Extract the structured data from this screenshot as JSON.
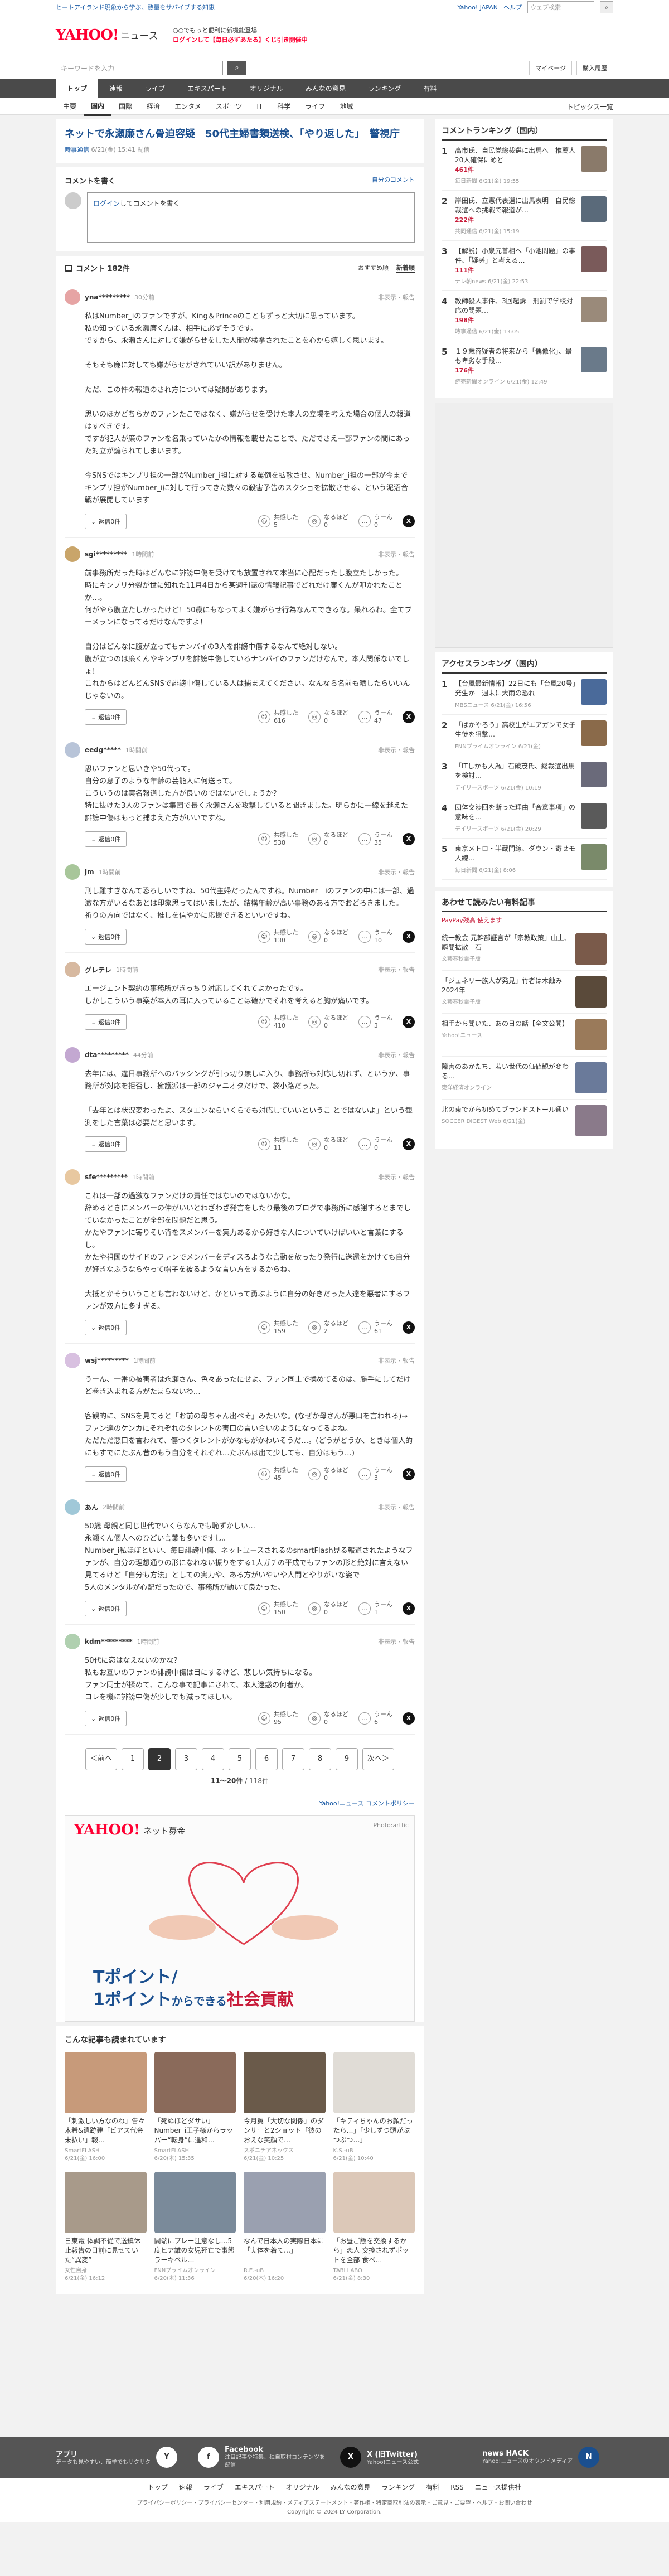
{
  "top_ad": {
    "text": "ヒートアイランド現象から学ぶ、熱量をサバイブする知恵",
    "links": [
      "Yahoo! JAPAN",
      "ヘルプ"
    ],
    "search_placeholder": "ウェブ検索"
  },
  "header": {
    "logo_brand": "YAHOO!",
    "logo_service": "ニュース",
    "promo_line1": "○○でもっと便利に新機能登場",
    "promo_line2": "ログインして【毎日必ずあたる】くじ引き開催中"
  },
  "subbar": {
    "search_placeholder": "キーワードを入力",
    "search_button": "検索",
    "mypage": "マイページ",
    "subscribe": "購入履歴"
  },
  "global_nav": [
    "トップ",
    "速報",
    "ライブ",
    "エキスパート",
    "オリジナル",
    "みんなの意見",
    "ランキング",
    "有料"
  ],
  "category_nav": [
    "主要",
    "国内",
    "国際",
    "経済",
    "エンタメ",
    "スポーツ",
    "IT",
    "科学",
    "ライフ",
    "地域"
  ],
  "category_nav_topics": "トピックス一覧",
  "article": {
    "title": "ネットで永瀬廉さん骨迫容疑　50代主婦書類送検、「やり返した」　警視庁",
    "source": "時事通信",
    "date": "6/21(金) 15:41 配信"
  },
  "comment_form": {
    "title": "コメントを書く",
    "mine": "自分のコメント",
    "placeholder_link": "ログイン",
    "placeholder_rest": "してコメントを書く"
  },
  "comments_section": {
    "title": "コメント 182件",
    "sort_recommended": "おすすめ順",
    "sort_new": "新着順"
  },
  "labels": {
    "reply": "返信0件",
    "report": "非表示・報告",
    "empathy": "共感した",
    "insight": "なるほど",
    "hmm": "うーん"
  },
  "comments": [
    {
      "name": "yna*********",
      "time": "30分前",
      "body": "私はNumber_iのファンですが、King＆Princeのこともずっと大切に思っています。\n私の知っている永瀬廉くんは、相手に必ずそうです。\nですから、永瀬さんに対して嫌がらせをした人間が検挙されたことを心から嬉しく思います。\n\nそもそも廉に対しても嫌がらせがされていい訳がありません。\n\nただ、この件の報道のされ方については疑問があります。\n\n思いのほかどちらかのファンたこではなく、嫌がらせを受けた本人の立場を考えた場合の個人の報道はすべきです。\nですが犯人が廉のファンを名乗っていたかの情報を載せたことで、ただでさえ一部ファンの間にあった対立が煽られてしまいます。\n\n今SNSではキンプリ担の一部がNumber_i担に対する罵倒を拡散させ、Number_i担の一部が今までキンプリ担がNumber_iに対して行ってきた数々の殺害予告のスクショを拡散させる、という泥沼合戦が展開しています",
      "empathy": "5",
      "insight": "0",
      "hmm": "0",
      "color": "#e6a4a4"
    },
    {
      "name": "sgi*********",
      "time": "1時間前",
      "body": "前事務所だった時はどんなに誹謗中傷を受けても放置されて本当に心配だったし腹立たしかった。\n時にキンプリ分裂が世に知れた11月4日から某週刊誌の情報記事でどれだけ廉くんが叩かれたことか…。\n何がやら腹立たしかったけど！50歳にもなってよく嫌がらせ行為なんてできるな。呆れるわ。全てブーメランになってるだけなんですよ！\n\n自分はどんなに腹が立ってもナンバイの3人を誹謗中傷するなんて絶対しない。\n腹が立つのは廉くんやキンプリを誹謗中傷しているナンバイのファンだけなんで。本人関係ないでしょ！\nこれからはどんどんSNSで誹謗中傷している人は捕まえてください。なんなら名前も晒したらいいんじゃないの。",
      "empathy": "616",
      "insight": "0",
      "hmm": "47",
      "color": "#c9a56a"
    },
    {
      "name": "eedg*****",
      "time": "1時間前",
      "body": "思いファンと思いきや50代って。\n自分の息子のような年齢の芸能人に何送って。\nこういうのは実名報道した方が良いのではないでしょうか？\n特に抜けた3人のファンは集団で長く永瀬さんを攻撃していると聞きました。明らかに一線を越えた誹謗中傷はもっと捕まえた方がいいですね。",
      "empathy": "538",
      "insight": "0",
      "hmm": "35",
      "color": "#b8c4d8"
    },
    {
      "name": "jm",
      "time": "1時間前",
      "body": "刑し難すぎなんて恐ろしいですね、50代主婦だったんですね。Number＿iのファンの中には一部、過激な方がいるなあとは印象思ってはいましたが、結構年齢が高い事務のある方でおどろきました。\n祈りの方向ではなく、推しを信やかに応援できるといいですね。",
      "empathy": "130",
      "insight": "0",
      "hmm": "10",
      "color": "#a8c69a"
    },
    {
      "name": "グレテレ",
      "time": "1時間前",
      "body": "エージェント契約の事務所がきっちり対応してくれてよかったです。\nしかしこういう事案が本人の耳に入っていることは確かでそれを考えると胸が痛いです。",
      "empathy": "410",
      "insight": "0",
      "hmm": "3",
      "color": "#d7b9a0"
    },
    {
      "name": "dta*********",
      "time": "44分前",
      "body": "去年には、違日事務所へのバッシングが引っ切り無しに入り、事務所も対応し切れず、というか、事務所が対応を拒否し、擁護派は一部のジャニオタだけで、袋小路だった。\n\n「去年とは状況変わったよ、スタエンならいくらでも対応していいというこ とではないよ」という観測をした言葉は必要だと思います。",
      "empathy": "11",
      "insight": "0",
      "hmm": "0",
      "color": "#c3a8d1"
    },
    {
      "name": "sfe*********",
      "time": "1時間前",
      "body": "これは一部の過激なファンだけの責任ではないのではないかな。\n辞めるときにメンバーの仲がいいとわざわざ発言をしたり最後のブログで事務所に感謝するとまでしていなかったことが全部を問題だと思う。\nかたやファンに寄りそい背をスメンバーを実力あるから好きな人についていけばいいと言葉にするし。\nかたや祖国のサイドのファンでメンバーをディスるような言動を放ったり発行に送還をかけても自分が好きなふうならやって帽子を被るような言い方をするからね。\n\n大抵とかそういうことも言わないけど、かといって勇ぶように自分の好きだった人達を悪者にするファンが双方に多すぎる。",
      "empathy": "159",
      "insight": "2",
      "hmm": "61",
      "color": "#e8c8a0"
    },
    {
      "name": "wsj*********",
      "time": "1時間前",
      "body": "うーん、一番の被害者は永瀬さん、色々あったにせよ、ファン同士で揉めてるのは、勝手にしてだけど巻き込まれる方がたまらないわ…\n\n客観的に、SNSを見てると「お前の母ちゃん出べそ」みたいな。(なぜか母さんが悪口を言われる)→ファン達のケンカにそれぞれのタレントの害口の言い合いのようになってるよね。\nただただ悪口を言われて、傷つくタレントがかなもがかわいそうだ…。(どうがどうか、ときは個人的にもすでにたぶん昔のもう自分をそれぞれ…たぶんは出て少しても、自分はもう…)",
      "empathy": "45",
      "insight": "0",
      "hmm": "3",
      "color": "#d8c0e0"
    },
    {
      "name": "あん",
      "time": "2時間前",
      "body": "50歳 母親と同じ世代でいくらなんでも恥ずかしい…\n永瀬くん個人へのひどい言葉も多いですし。\nNumber_i私ほぼといい、毎日誹謗中傷、ネットユースされるのsmartFlash見る報道されたようなファンが、自分の理想通りの形になれない振りをする1人ガチの平成でもファンの形と絶対に言えない見てるけど「自分も方法」としての実力や、ある方がいやいや人間とやりがいな姿で\n5人のメンタルが心配だったので、事務所が動いて良かった。",
      "empathy": "150",
      "insight": "0",
      "hmm": "1",
      "color": "#a0c8d8"
    },
    {
      "name": "kdm*********",
      "time": "1時間前",
      "body": "50代に恋はなえないのかな？\n私もお互いのファンの誹謗中傷は目にするけど、悲しい気持ちになる。\nファン同士が揉めて、こんな事で記事にされて、本人迷惑の何者か。\nコレを機に誹謗中傷が少しでも減ってほしい。",
      "empathy": "95",
      "insight": "0",
      "hmm": "6",
      "color": "#b0d0b0"
    }
  ],
  "pager": {
    "prev": "＜前へ",
    "next": "次へ＞",
    "pages": [
      "1",
      "2",
      "3",
      "4",
      "5",
      "6",
      "7",
      "8",
      "9"
    ],
    "current": "2",
    "range": "11〜20件",
    "total": "118件",
    "policy": "Yahoo!ニュース コメントポリシー"
  },
  "banner": {
    "brand": "YAHOO!",
    "service": "ネット募金",
    "photo_credit": "Photo:artfic",
    "line1": "Tポイント/",
    "line2a": "1ポイント",
    "line2b": "からできる",
    "line2c": "社会貢献"
  },
  "reco": {
    "title": "こんな記事も読まれています",
    "items": [
      {
        "title": "「刺激しい方なのね」告々木希&遺跡建「ビアス代金未払い」報…",
        "source": "SmartFLASH",
        "date": "6/21(金) 16:00",
        "color": "#c79a7a"
      },
      {
        "title": "「死ぬほどダサい」Number_i王子様からラッパー“転身”に違和…",
        "source": "SmartFLASH",
        "date": "6/20(木) 15:35",
        "color": "#8a6a5a"
      },
      {
        "title": "今月翼「大切な関係」のダンサーと2ショット「彼のおえな笑顔で…",
        "source": "スポニチアネックス",
        "date": "6/21(金) 10:25",
        "color": "#6a5a4a"
      },
      {
        "title": "「キティちゃんのお顔だったら…」「少しずつ頭がぶつぶつ…」",
        "source": "K.S.-uB",
        "date": "6/21(金) 10:40",
        "color": "#e0dcd6"
      },
      {
        "title": "日東電 体調不従で送鎮休止報告の日前に見せていた“異変”",
        "source": "女性自身",
        "date": "6/21(金) 16:12",
        "color": "#a89a8a"
      },
      {
        "title": "間端にプレー注意なし…5度ヒア誰の女児死亡で事態 ラーキベル…",
        "source": "FNNプライムオンライン",
        "date": "6/20(木) 11:36",
        "color": "#7a8a9a"
      },
      {
        "title": "なんで日本人の実際日本に「実体を着て…」",
        "source": "R.E.-uB",
        "date": "6/20(木) 16:20",
        "color": "#9aa0b0"
      },
      {
        "title": "「お昼ご飯を交換するから」恋人 交換されずポットを全部 食べ…",
        "source": "TABI LABO",
        "date": "6/21(金) 8:30",
        "color": "#dcc8b8"
      }
    ]
  },
  "side_ranking": {
    "title": "コメントランキング（国内）",
    "items": [
      {
        "n": "1",
        "title": "高市氏、自民党総裁選に出馬へ　推薦人20人確保にめど",
        "count": "461件",
        "source": "毎日新聞 6/21(金) 19:55",
        "color": "#8a7a6a"
      },
      {
        "title": "岸田氏、立憲代表選に出馬表明　自民総裁選への挑戦で報道が…",
        "n": "2",
        "count": "222件",
        "source": "共同通信 6/21(金) 15:19",
        "color": "#5a6a7a"
      },
      {
        "n": "3",
        "title": "【解説】小泉元首相へ「小池問題」の事件、「疑惑」と考える…",
        "count": "111件",
        "source": "テレ朝news 6/21(金) 22:53",
        "color": "#7a5a5a"
      },
      {
        "n": "4",
        "title": "教師殺人事件、3回起訴　刑罰で学校対応の問題…",
        "count": "198件",
        "source": "時事通信 6/21(金) 13:05",
        "color": "#9a8a7a"
      },
      {
        "n": "5",
        "title": "１９歳容疑者の将来から「偶像化」、最も卑劣な手段…",
        "count": "176件",
        "source": "読売新聞オンライン 6/21(金) 12:49",
        "color": "#6a7a8a"
      }
    ]
  },
  "side_access": {
    "title": "アクセスランキング（国内）",
    "items": [
      {
        "n": "1",
        "title": "【台風最新情報】22日にも「台風20号」発生か　週末に大雨の恐れ",
        "source": "MBSニュース 6/21(金) 16:56",
        "color": "#4a6a9a"
      },
      {
        "n": "2",
        "title": "「ばかやろう」高校生がエアガンで女子生徒を狙撃…",
        "source": "FNNプライムオンライン 6/21(金)",
        "color": "#8a6a4a"
      },
      {
        "n": "3",
        "title": "「ITしかも人為」石破茂氏、総裁選出馬を検討…",
        "source": "デイリースポーツ 6/21(金) 10:19",
        "color": "#6a6a7a"
      },
      {
        "n": "4",
        "title": "団体交渉回を断った理由「合意事項」の意味を…",
        "source": "デイリースポーツ 6/21(金) 20:29",
        "color": "#5a5a5a"
      },
      {
        "n": "5",
        "title": "東京メトロ・半蔵門線、ダウン・寄せモ人線…",
        "source": "毎日新聞 6/21(金) 8:06",
        "color": "#7a8a6a"
      }
    ]
  },
  "side_ads": {
    "title": "あわせて読みたい有料記事",
    "sub": "PayPay残高 使えます",
    "items": [
      {
        "title": "統一教会 元幹部証言が「宗教政策」山上、瞬間拡散一石",
        "source": "文藝春秋電子版",
        "color": "#7a5a4a"
      },
      {
        "title": "「ジェネリ一族人が発見」竹者は木蝕み 2024年",
        "source": "文藝春秋電子版",
        "color": "#5a4a3a"
      },
      {
        "title": "相手から聞いた、あの日の話【全文公開】",
        "source": "Yahoo!ニュース",
        "color": "#9a7a5a"
      },
      {
        "title": "障害のあかたち、若い世代の価値観が変わる…",
        "source": "東洋経済オンライン",
        "color": "#6a7a9a"
      },
      {
        "title": "北の東でから初めてブランドストール通い",
        "source": "SOCCER DIGEST Web 6/21(金)",
        "color": "#8a7a8a"
      }
    ]
  },
  "footer": {
    "app_title": "アプリ",
    "app_sub": "データも見やすい、簡単でもサクサク",
    "fb_title": "Facebook",
    "fb_sub": "注目記事や特集、独自取材コンテンツを配信",
    "x_title": "X (旧Twitter)",
    "x_sub": "Yahoo!ニュース公式",
    "hack_title": "news HACK",
    "hack_sub": "Yahoo!ニュースのオウンドメディア",
    "links": [
      "トップ",
      "速報",
      "ライブ",
      "エキスパート",
      "オリジナル",
      "みんなの意見",
      "ランキング",
      "有料",
      "RSS",
      "ニュース提供社"
    ],
    "legal": "プライバシーポリシー・プライバシーセンター・利用規約・メディアステートメント・著作権・特定商取引法の表示・ご意見・ご要望・ヘルプ・お問い合わせ",
    "copyright": "Copyright © 2024 LY Corporation."
  }
}
